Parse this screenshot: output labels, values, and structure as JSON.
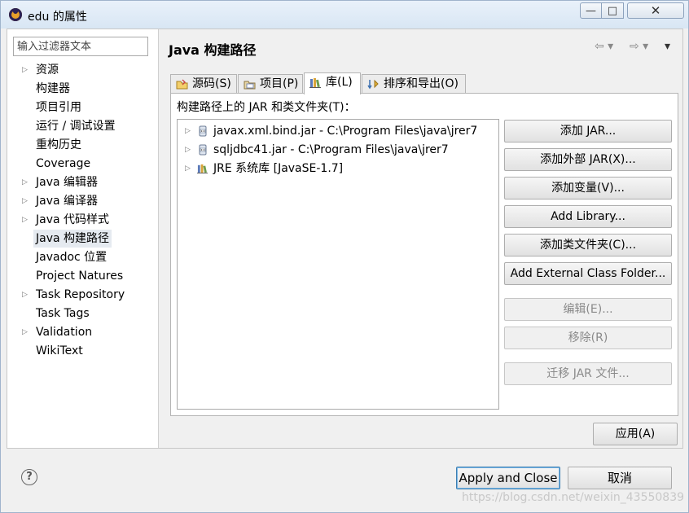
{
  "window": {
    "title": "edu 的属性",
    "minimize": "—",
    "maximize": "□",
    "close": "✕"
  },
  "sidebar": {
    "filter_placeholder": "输入过滤器文本",
    "items": [
      {
        "label": "资源",
        "expandable": true
      },
      {
        "label": "构建器",
        "expandable": false
      },
      {
        "label": "项目引用",
        "expandable": false
      },
      {
        "label": "运行 / 调试设置",
        "expandable": false
      },
      {
        "label": "重构历史",
        "expandable": false
      },
      {
        "label": "Coverage",
        "expandable": false
      },
      {
        "label": "Java 编辑器",
        "expandable": true
      },
      {
        "label": "Java 编译器",
        "expandable": true
      },
      {
        "label": "Java 代码样式",
        "expandable": true
      },
      {
        "label": "Java 构建路径",
        "expandable": false,
        "selected": true
      },
      {
        "label": "Javadoc 位置",
        "expandable": false
      },
      {
        "label": "Project Natures",
        "expandable": false
      },
      {
        "label": "Task Repository",
        "expandable": true
      },
      {
        "label": "Task Tags",
        "expandable": false
      },
      {
        "label": "Validation",
        "expandable": true
      },
      {
        "label": "WikiText",
        "expandable": false
      }
    ]
  },
  "header": {
    "title": "Java 构建路径",
    "back": "⇦ ▾",
    "forward": "⇨ ▾",
    "menu": "▾"
  },
  "tabs": [
    {
      "label": "源码(S)",
      "icon": "source-folder-icon",
      "active": false
    },
    {
      "label": "项目(P)",
      "icon": "project-icon",
      "active": false
    },
    {
      "label": "库(L)",
      "icon": "library-icon",
      "active": true
    },
    {
      "label": "排序和导出(O)",
      "icon": "order-export-icon",
      "active": false
    }
  ],
  "libraries": {
    "label": "构建路径上的 JAR 和类文件夹(T)：",
    "entries": [
      {
        "label": "javax.xml.bind.jar - C:\\Program Files\\java\\jrer7",
        "icon": "jar-icon"
      },
      {
        "label": "sqljdbc41.jar - C:\\Program Files\\java\\jrer7",
        "icon": "jar-icon"
      },
      {
        "label": "JRE 系统库 [JavaSE-1.7]",
        "icon": "library-icon"
      }
    ]
  },
  "buttons": {
    "add_jar": "添加 JAR...",
    "add_external_jar": "添加外部 JAR(X)...",
    "add_variable": "添加变量(V)...",
    "add_library": "Add Library...",
    "add_class_folder": "添加类文件夹(C)...",
    "add_external_class_folder": "Add External Class Folder...",
    "edit": "编辑(E)...",
    "remove": "移除(R)",
    "migrate_jar": "迁移 JAR 文件...",
    "apply": "应用(A)"
  },
  "footer": {
    "help": "?",
    "apply_and_close": "Apply and Close",
    "cancel": "取消",
    "watermark": "https://blog.csdn.net/weixin_43550839"
  }
}
